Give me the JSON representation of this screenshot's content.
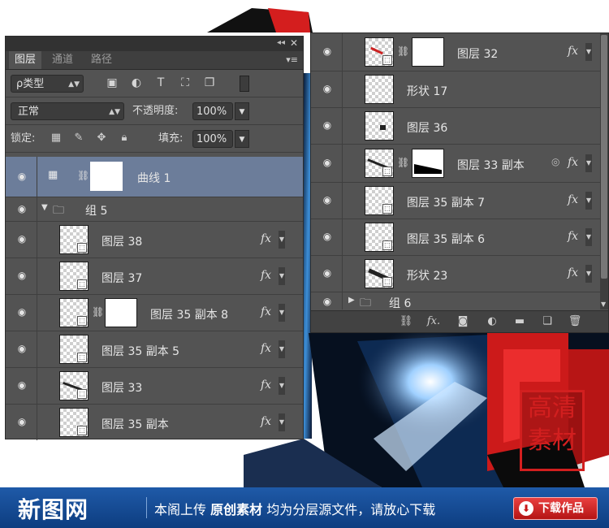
{
  "left_panel": {
    "tabs": [
      {
        "label": "图层",
        "active": true
      },
      {
        "label": "通道",
        "active": false
      },
      {
        "label": "路径",
        "active": false
      }
    ],
    "filter_select": "ρ类型",
    "blend_mode": "正常",
    "opacity_label": "不透明度:",
    "opacity_value": "100%",
    "lock_label": "锁定:",
    "fill_label": "填充:",
    "fill_value": "100%",
    "layers": [
      {
        "name": "曲线 1",
        "type": "adjustment",
        "selected": true
      },
      {
        "name": "组 5",
        "type": "group",
        "expanded": true
      },
      {
        "name": "图层 38",
        "fx": "fx",
        "indent": true
      },
      {
        "name": "图层 37",
        "fx": "fx",
        "indent": true
      },
      {
        "name": "图层 35 副本 8",
        "fx": "fx",
        "indent": true,
        "mask": true
      },
      {
        "name": "图层 35 副本 5",
        "fx": "fx",
        "indent": true
      },
      {
        "name": "图层 33",
        "fx": "fx",
        "indent": true
      },
      {
        "name": "图层 35 副本",
        "fx": "fx",
        "indent": true
      }
    ]
  },
  "right_panel": {
    "layers": [
      {
        "name": "图层 32",
        "fx": "fx",
        "mask": true
      },
      {
        "name": "形状 17",
        "fx": ""
      },
      {
        "name": "图层 36",
        "fx": ""
      },
      {
        "name": "图层 33 副本",
        "fx": "fx",
        "mask": true
      },
      {
        "name": "图层 35 副本 7",
        "fx": "fx"
      },
      {
        "name": "图层 35 副本 6",
        "fx": "fx"
      },
      {
        "name": "形状 23",
        "fx": "fx"
      },
      {
        "name": "组 6",
        "type": "group",
        "expanded": false
      }
    ],
    "footer_icons": [
      "link-icon",
      "fx-icon",
      "mask-icon",
      "adjustment-icon",
      "folder-icon",
      "new-layer-icon",
      "trash-icon"
    ]
  },
  "stamp": {
    "line1": "高清",
    "line2": "素材"
  },
  "banner": {
    "logo": "新图网",
    "text_plain1": "本阁上传",
    "text_bold": "原创素材",
    "text_plain2": "均为分层源文件，请放心下载",
    "download_label": "下载作品",
    "colors": {
      "bar": "#1f5aa8",
      "button": "#d42020"
    }
  }
}
